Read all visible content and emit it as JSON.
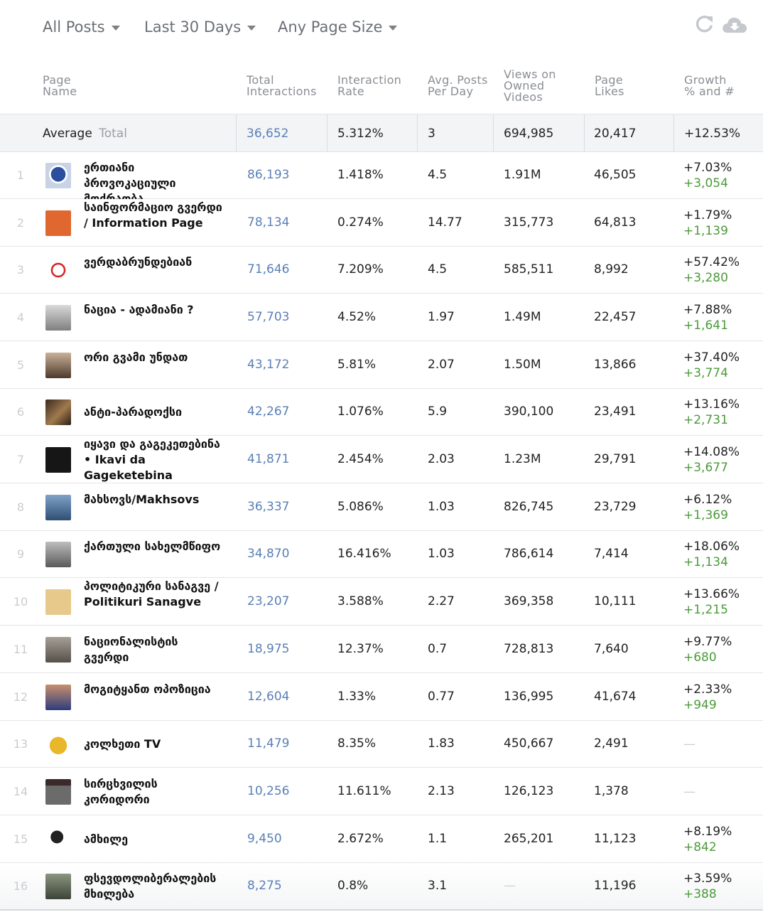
{
  "toolbar": {
    "filters": [
      "All Posts",
      "Last 30 Days",
      "Any Page Size"
    ],
    "icons": [
      "refresh-icon",
      "cloud-download-icon"
    ]
  },
  "columns": {
    "page_name": "Page\nName",
    "total_interactions": "Total\nInteractions",
    "interaction_rate": "Interaction\nRate",
    "avg_posts": "Avg. Posts\nPer Day",
    "views": "Views on\nOwned\nVideos",
    "page_likes": "Page\nLikes",
    "growth": "Growth\n% and #"
  },
  "average": {
    "label": "Average",
    "sublabel": "Total",
    "total_interactions": "36,652",
    "interaction_rate": "5.312%",
    "avg_posts": "3",
    "views": "694,985",
    "page_likes": "20,417",
    "growth": "+12.53%"
  },
  "rows": [
    {
      "rank": "1",
      "name": "ერთიანი პროვოკაციული მოძრაობა",
      "total": "86,193",
      "rate": "1.418%",
      "posts": "4.5",
      "views": "1.91M",
      "likes": "46,505",
      "growth_pct": "+7.03%",
      "growth_num": "+3,054"
    },
    {
      "rank": "2",
      "name": "საინფორმაციო გვერდი / Information Page",
      "total": "78,134",
      "rate": "0.274%",
      "posts": "14.77",
      "views": "315,773",
      "likes": "64,813",
      "growth_pct": "+1.79%",
      "growth_num": "+1,139"
    },
    {
      "rank": "3",
      "name": "ვერდაბრუნდებიან",
      "total": "71,646",
      "rate": "7.209%",
      "posts": "4.5",
      "views": "585,511",
      "likes": "8,992",
      "growth_pct": "+57.42%",
      "growth_num": "+3,280"
    },
    {
      "rank": "4",
      "name": "ნაცია - ადამიანი ?",
      "total": "57,703",
      "rate": "4.52%",
      "posts": "1.97",
      "views": "1.49M",
      "likes": "22,457",
      "growth_pct": "+7.88%",
      "growth_num": "+1,641"
    },
    {
      "rank": "5",
      "name": "ორი გვამი უნდათ",
      "total": "43,172",
      "rate": "5.81%",
      "posts": "2.07",
      "views": "1.50M",
      "likes": "13,866",
      "growth_pct": "+37.40%",
      "growth_num": "+3,774"
    },
    {
      "rank": "6",
      "name": "ანტი-პარადოქსი",
      "total": "42,267",
      "rate": "1.076%",
      "posts": "5.9",
      "views": "390,100",
      "likes": "23,491",
      "growth_pct": "+13.16%",
      "growth_num": "+2,731"
    },
    {
      "rank": "7",
      "name": "იყავი და გაგეკეთებინა • Ikavi da Gageketebina",
      "total": "41,871",
      "rate": "2.454%",
      "posts": "2.03",
      "views": "1.23M",
      "likes": "29,791",
      "growth_pct": "+14.08%",
      "growth_num": "+3,677"
    },
    {
      "rank": "8",
      "name": "მახსოვს/Makhsovs",
      "total": "36,337",
      "rate": "5.086%",
      "posts": "1.03",
      "views": "826,745",
      "likes": "23,729",
      "growth_pct": "+6.12%",
      "growth_num": "+1,369"
    },
    {
      "rank": "9",
      "name": "ქართული სახელმწიფო",
      "total": "34,870",
      "rate": "16.416%",
      "posts": "1.03",
      "views": "786,614",
      "likes": "7,414",
      "growth_pct": "+18.06%",
      "growth_num": "+1,134"
    },
    {
      "rank": "10",
      "name": "პოლიტიკური სანაგვე / Politikuri Sanagve",
      "total": "23,207",
      "rate": "3.588%",
      "posts": "2.27",
      "views": "369,358",
      "likes": "10,111",
      "growth_pct": "+13.66%",
      "growth_num": "+1,215"
    },
    {
      "rank": "11",
      "name": "ნაციონალისტის გვერდი",
      "total": "18,975",
      "rate": "12.37%",
      "posts": "0.7",
      "views": "728,813",
      "likes": "7,640",
      "growth_pct": "+9.77%",
      "growth_num": "+680"
    },
    {
      "rank": "12",
      "name": "მოგიტყანთ ოპოზიცია",
      "total": "12,604",
      "rate": "1.33%",
      "posts": "0.77",
      "views": "136,995",
      "likes": "41,674",
      "growth_pct": "+2.33%",
      "growth_num": "+949"
    },
    {
      "rank": "13",
      "name": "კოლხეთი TV",
      "total": "11,479",
      "rate": "8.35%",
      "posts": "1.83",
      "views": "450,667",
      "likes": "2,491",
      "growth_pct": "—",
      "growth_num": ""
    },
    {
      "rank": "14",
      "name": "სირცხვილის კორიდორი",
      "total": "10,256",
      "rate": "11.611%",
      "posts": "2.13",
      "views": "126,123",
      "likes": "1,378",
      "growth_pct": "—",
      "growth_num": ""
    },
    {
      "rank": "15",
      "name": "ამხილე",
      "total": "9,450",
      "rate": "2.672%",
      "posts": "1.1",
      "views": "265,201",
      "likes": "11,123",
      "growth_pct": "+8.19%",
      "growth_num": "+842"
    },
    {
      "rank": "16",
      "name": "ფსევდოლიბერალების მხილება",
      "total": "8,275",
      "rate": "0.8%",
      "posts": "3.1",
      "views": "—",
      "likes": "11,196",
      "growth_pct": "+3.59%",
      "growth_num": "+388"
    }
  ]
}
